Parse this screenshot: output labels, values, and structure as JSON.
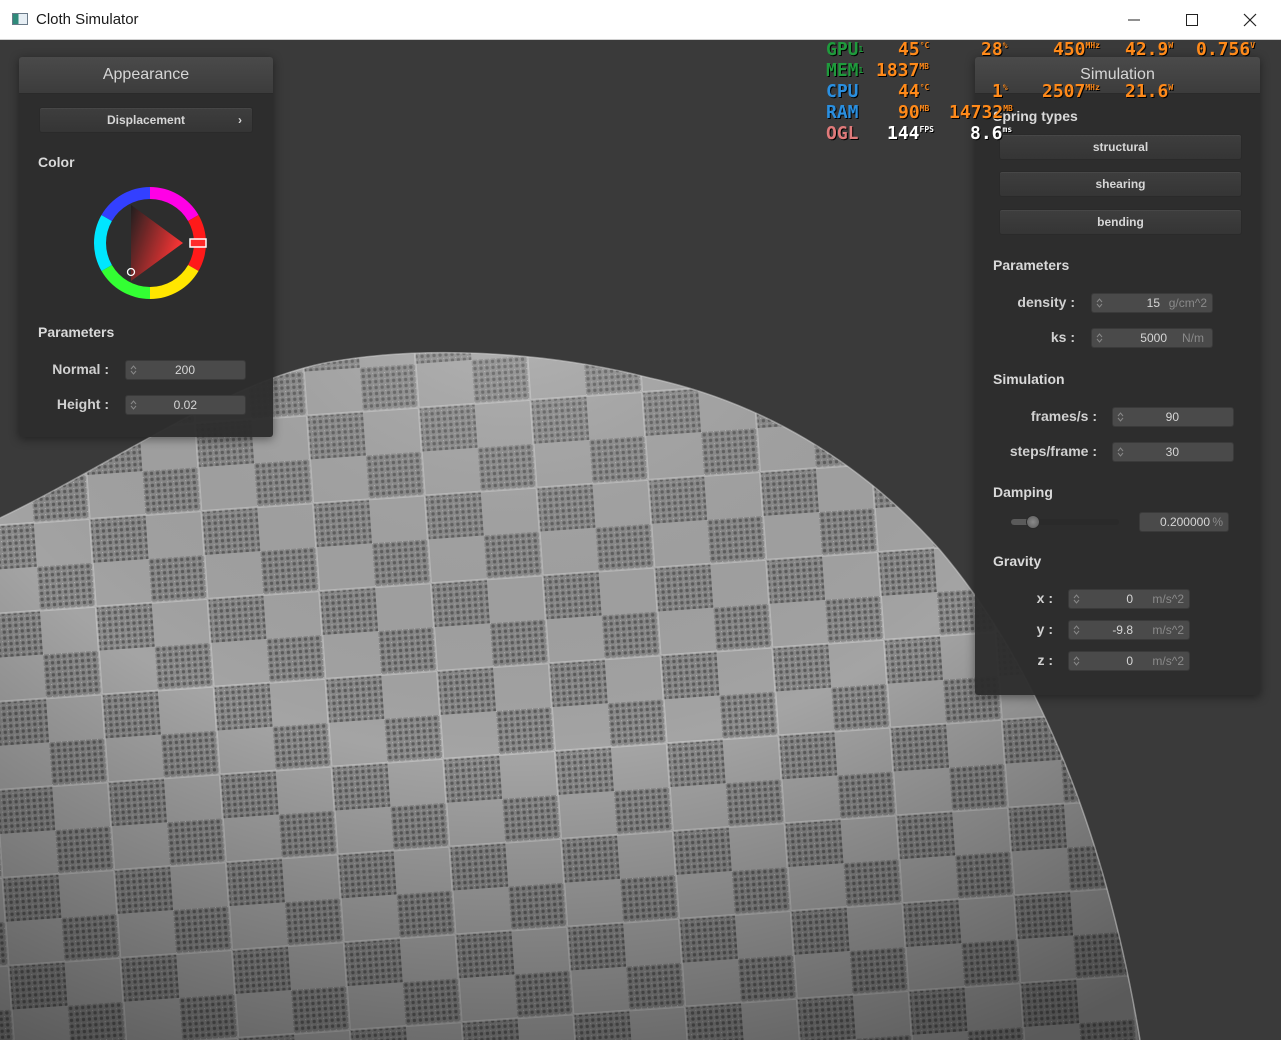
{
  "window": {
    "title": "Cloth Simulator"
  },
  "appearance": {
    "header": "Appearance",
    "mode_button": "Displacement",
    "mode_chevron": "›",
    "color_label": "Color",
    "parameters_label": "Parameters",
    "normal": {
      "label": "Normal :",
      "value": "200"
    },
    "height": {
      "label": "Height :",
      "value": "0.02"
    }
  },
  "simulation": {
    "header": "Simulation",
    "spring_types_label": "Spring types",
    "spring_buttons": [
      "structural",
      "shearing",
      "bending"
    ],
    "parameters_label": "Parameters",
    "density": {
      "label": "density :",
      "value": "15",
      "unit": "g/cm^2"
    },
    "ks": {
      "label": "ks :",
      "value": "5000",
      "unit": "N/m"
    },
    "simulation_label": "Simulation",
    "frames": {
      "label": "frames/s :",
      "value": "90"
    },
    "steps": {
      "label": "steps/frame :",
      "value": "30"
    },
    "damping_label": "Damping",
    "damping": {
      "value": "0.200000",
      "unit": "%",
      "slider_fraction": 0.2
    },
    "gravity_label": "Gravity",
    "gravity": {
      "x": {
        "label": "x :",
        "value": "0",
        "unit": "m/s^2"
      },
      "y": {
        "label": "y :",
        "value": "-9.8",
        "unit": "m/s^2"
      },
      "z": {
        "label": "z :",
        "value": "0",
        "unit": "m/s^2"
      }
    }
  },
  "osd": {
    "colors": {
      "gpu": "#1f9a3c",
      "mem": "#1f9a3c",
      "cpu": "#2a8fe0",
      "ram": "#2a8fe0",
      "ogl": "#e07a7a",
      "value": "#ff8a1a",
      "white": "#ffffff"
    },
    "gpu": {
      "label": "GPU",
      "sub": "1",
      "temp": "45",
      "temp_unit": "°C",
      "load": "28",
      "load_unit": "%",
      "clock": "450",
      "clock_unit": "MHz",
      "power": "42.9",
      "power_unit": "W",
      "voltage": "0.756",
      "voltage_unit": "V"
    },
    "mem": {
      "label": "MEM",
      "sub": "1",
      "value": "1837",
      "unit": "MB"
    },
    "cpu": {
      "label": "CPU",
      "temp": "44",
      "temp_unit": "°C",
      "load": "1",
      "load_unit": "%",
      "clock": "2507",
      "clock_unit": "MHz",
      "power": "21.6",
      "power_unit": "W"
    },
    "ram": {
      "label": "RAM",
      "value": "90",
      "unit": "MB",
      "value2": "14732",
      "unit2": "MB"
    },
    "ogl": {
      "label": "OGL",
      "fps": "144",
      "fps_unit": "FPS",
      "ms": "8.6",
      "ms_unit": "ms"
    }
  }
}
